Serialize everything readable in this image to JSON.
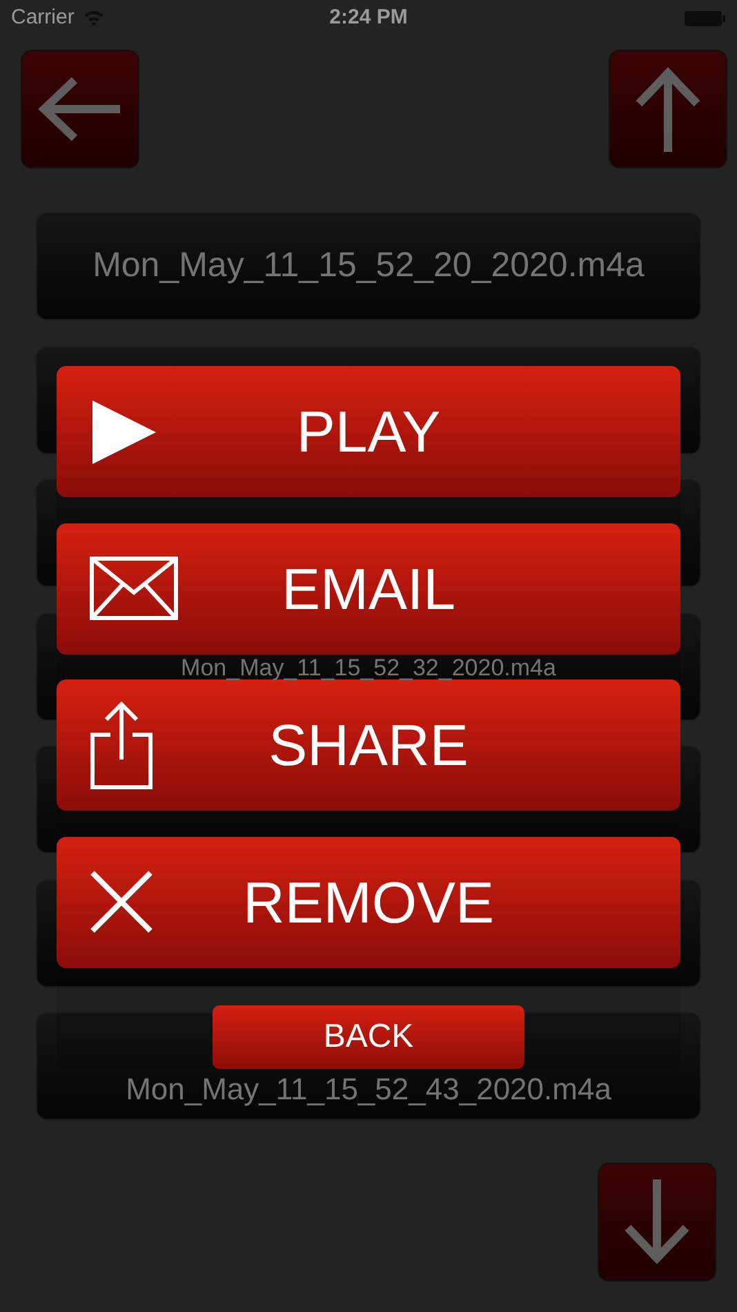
{
  "status_bar": {
    "carrier": "Carrier",
    "time": "2:24 PM"
  },
  "files": [
    {
      "kind": "label",
      "name": "Mon_May_11_15_52_20_2020.m4a"
    },
    {
      "kind": "covered"
    },
    {
      "kind": "covered"
    },
    {
      "kind": "label",
      "name": "Mon_May_11_15_52_32_2020.m4a"
    },
    {
      "kind": "covered"
    },
    {
      "kind": "covered"
    },
    {
      "kind": "label",
      "name": "Mon_May_11_15_52_43_2020.m4a"
    }
  ],
  "actions": [
    {
      "kind": "play",
      "label": "PLAY"
    },
    {
      "kind": "email",
      "label": "EMAIL"
    },
    {
      "kind": "share",
      "label": "SHARE"
    },
    {
      "kind": "remove",
      "label": "REMOVE"
    }
  ],
  "back_button": {
    "label": "BACK"
  }
}
